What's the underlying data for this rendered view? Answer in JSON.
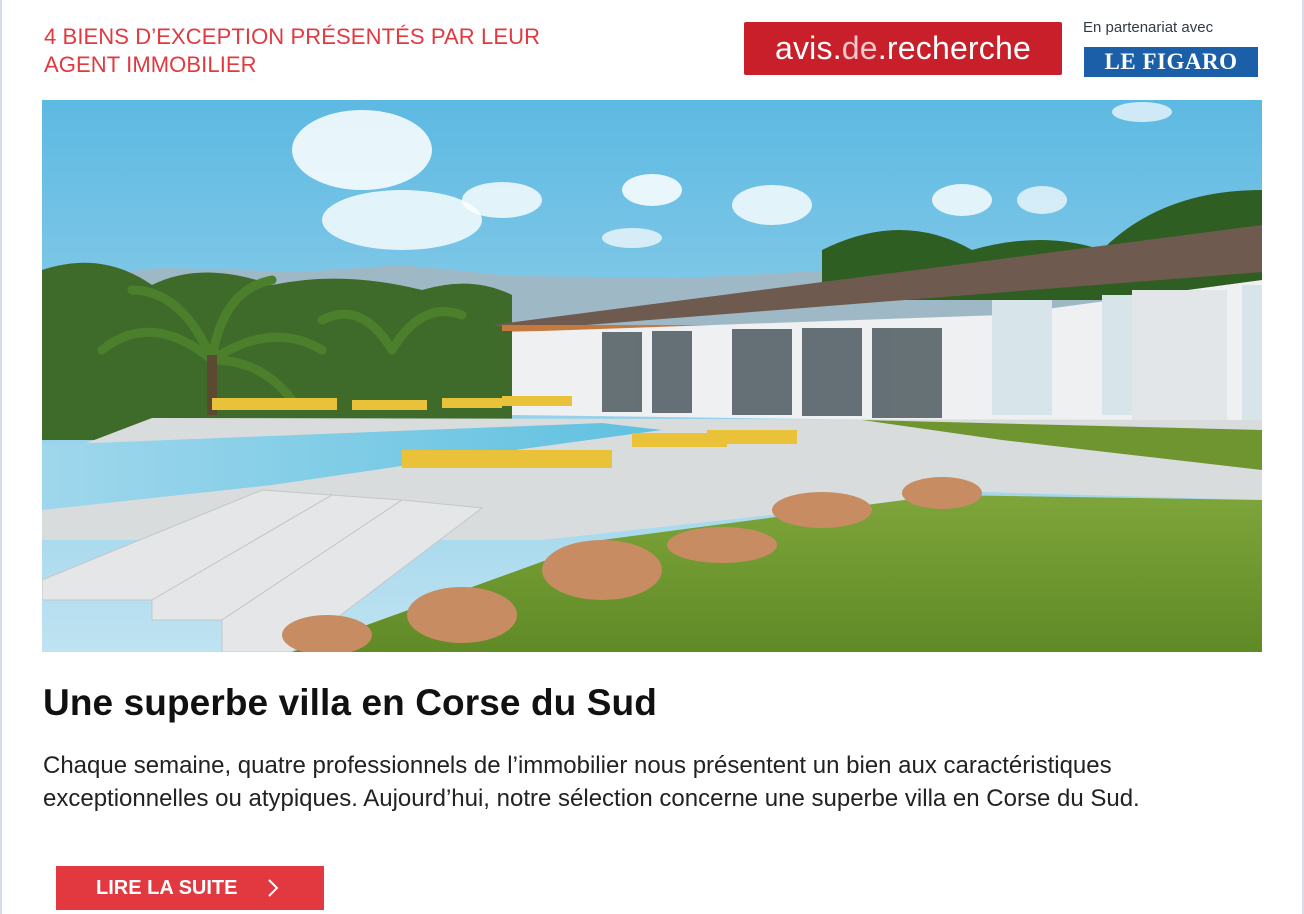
{
  "header": {
    "tagline_line1": "4 BIENS D’EXCEPTION PRÉSENTÉS PAR LEUR",
    "tagline_line2": "AGENT IMMOBILIER",
    "brand_part1": "avis",
    "brand_part2": ".",
    "brand_part3": "de",
    "brand_part4": ".",
    "brand_part5": "recherche",
    "partner_label": "En partenariat avec",
    "partner_logo": "LE FIGARO"
  },
  "colors": {
    "accent_red": "#e2383f",
    "brand_red": "#c91f2b",
    "figaro_blue": "#1b5fa8"
  },
  "hero": {
    "icon": "villa-pool-photo"
  },
  "article": {
    "title": "Une superbe villa en Corse du Sud",
    "text": "Chaque semaine, quatre professionnels de l’immobilier nous présentent un bien aux caractéristiques exceptionnelles ou atypiques. Aujourd’hui, notre sélection concerne une superbe villa en Corse du Sud."
  },
  "cta": {
    "label": "LIRE LA SUITE",
    "icon": "chevron-right-icon"
  }
}
